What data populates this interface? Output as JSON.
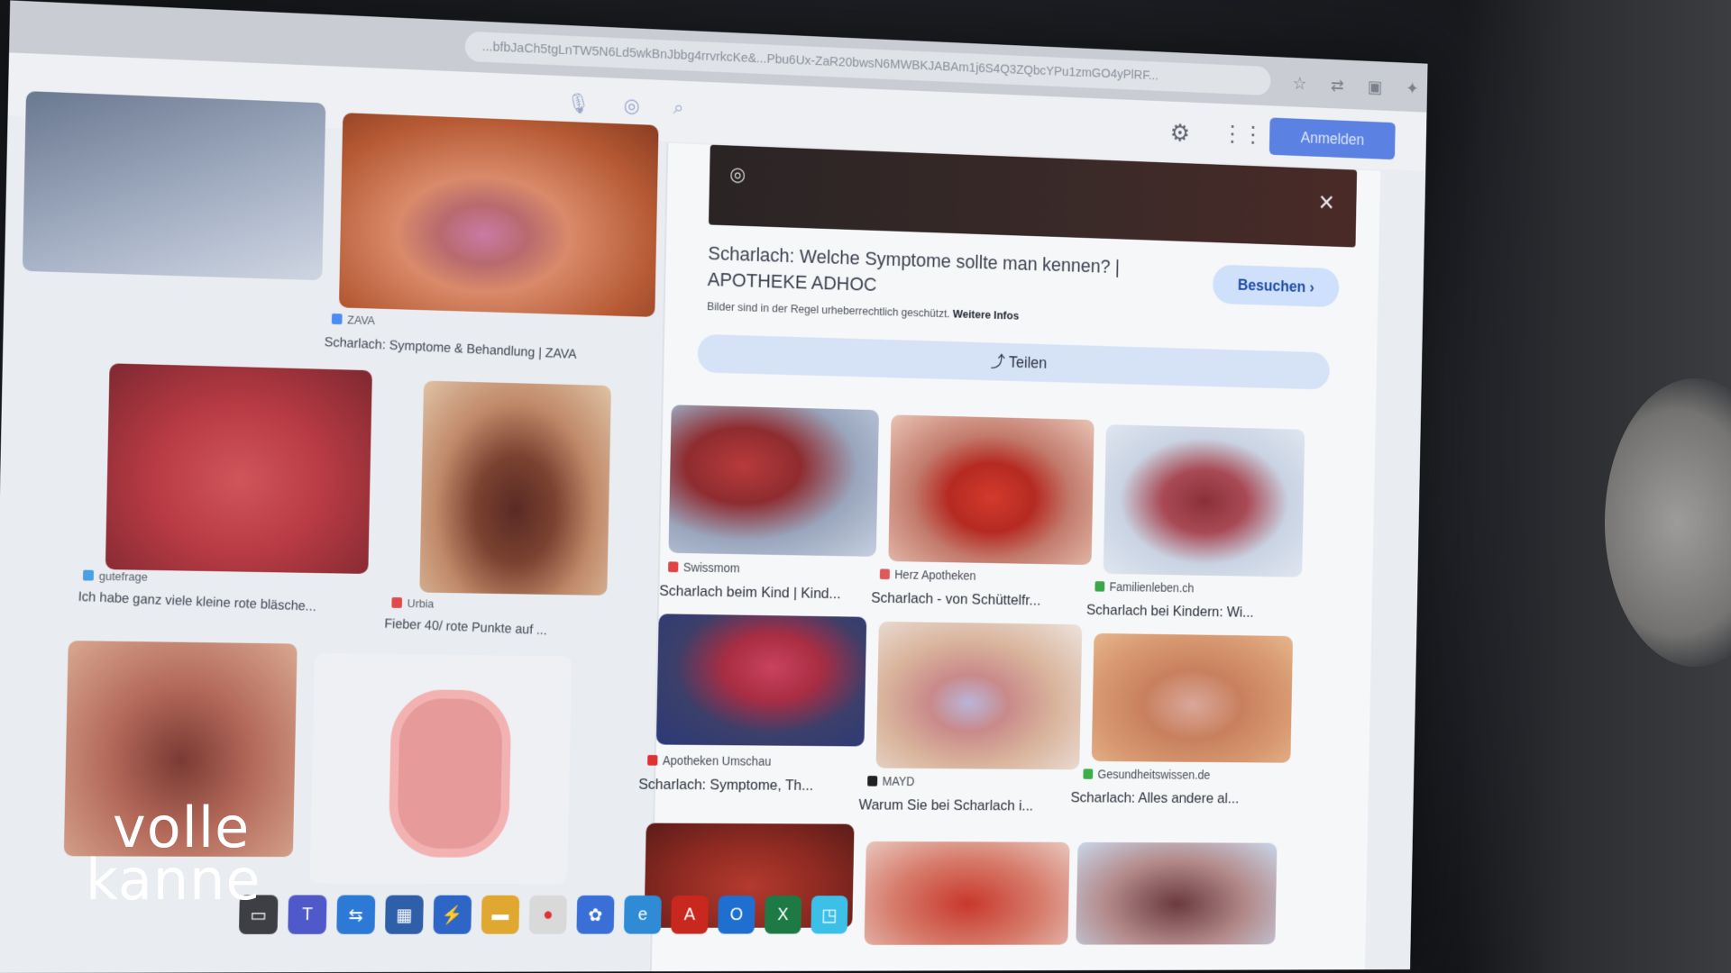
{
  "browser": {
    "url": "...bfbJaCh5tgLnTW5N6Ld5wkBnJbbg4rrvrkcKe&...Pbu6Ux-ZaR20bwsN6MWBKJABAm1j6S4Q3ZQbcYPu1zmGO4yPlRF..."
  },
  "google": {
    "signin_label": "Anmelden"
  },
  "grid": [
    {
      "source": "",
      "caption": ""
    },
    {
      "source": "ZAVA",
      "caption": "Scharlach: Symptome & Behandlung | ZAVA"
    },
    {
      "source": "gutefrage",
      "caption": "Ich habe ganz viele kleine rote bläsche..."
    },
    {
      "source": "Urbia",
      "caption": "Fieber 40/ rote Punkte auf ..."
    }
  ],
  "panel": {
    "title": "Scharlach: Welche Symptome sollte man kennen? | APOTHEKE ADHOC",
    "copyright_note": "Bilder sind in der Regel urheberrechtlich geschützt.",
    "more_info": "Weitere Infos",
    "visit_label": "Besuchen",
    "share_label": "Teilen",
    "related": [
      {
        "source": "Swissmom",
        "caption": "Scharlach beim Kind | Kind..."
      },
      {
        "source": "Herz Apotheken",
        "caption": "Scharlach - von Schüttelfr..."
      },
      {
        "source": "Familienleben.ch",
        "caption": "Scharlach bei Kindern: Wi..."
      },
      {
        "source": "Apotheken Umschau",
        "caption": "Scharlach: Symptome, Th..."
      },
      {
        "source": "MAYD",
        "caption": "Warum Sie bei Scharlach i..."
      },
      {
        "source": "Gesundheitswissen.de",
        "caption": "Scharlach: Alles andere al..."
      }
    ]
  },
  "watermark": {
    "line1": "volle",
    "line2": "kanne"
  },
  "icons": {
    "lens": "google-lens-icon",
    "close": "close-icon",
    "share": "share-icon",
    "settings": "gear-icon",
    "apps": "apps-grid-icon",
    "star": "star-icon"
  }
}
